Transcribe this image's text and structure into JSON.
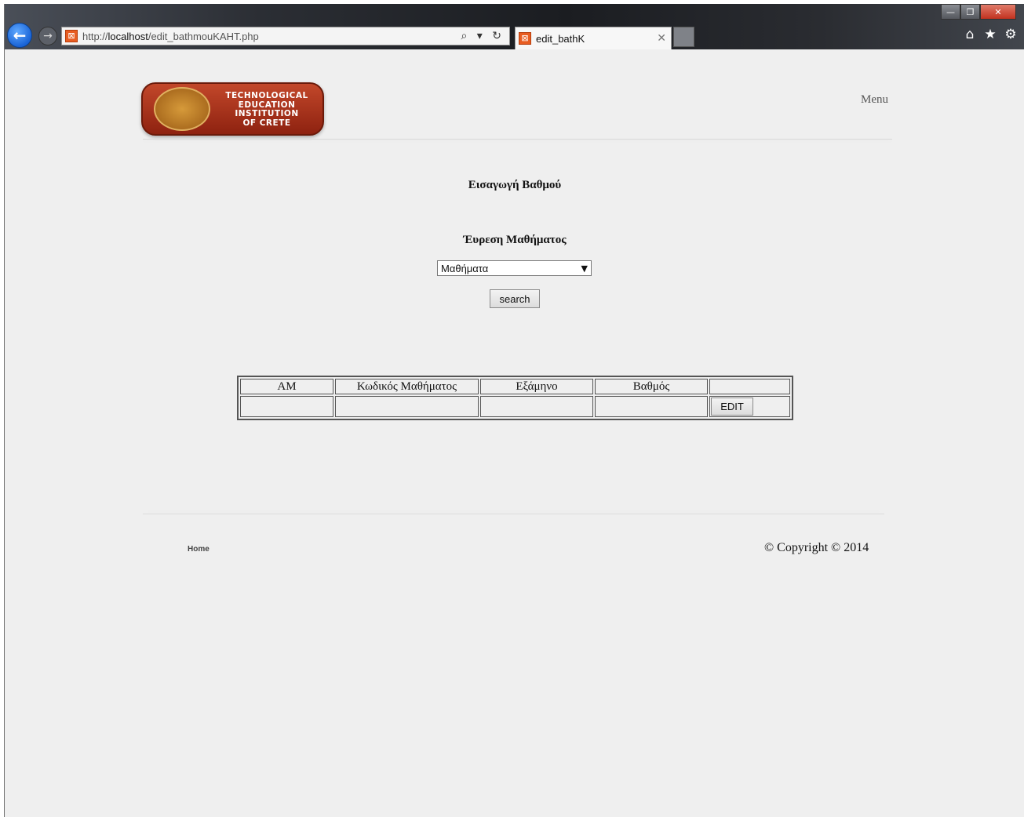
{
  "browser": {
    "url_prefix": "http://",
    "url_host": "localhost",
    "url_path": "/edit_bathmouKAHT.php",
    "tab_title": "edit_bathK",
    "address_tools": "⌕ ▾ ↻"
  },
  "header": {
    "logo_text": [
      "TECHNOLOGICAL",
      "EDUCATION",
      "INSTITUTION",
      "OF CRETE"
    ],
    "menu_label": "Menu"
  },
  "main": {
    "title": "Εισαγωγή Βαθμού",
    "search_title": "Έυρεση Μαθήματος",
    "course_select_value": "Μαθήματα",
    "search_button": "search"
  },
  "table": {
    "headers": [
      "AM",
      "Κωδικός Μαθήματος",
      "Εξάμηνο",
      "Βαθμός",
      ""
    ],
    "row": [
      "",
      "",
      "",
      ""
    ],
    "edit_button": "EDIT"
  },
  "footer": {
    "home_link": "Home",
    "copyright": "© Copyright © 2014"
  }
}
